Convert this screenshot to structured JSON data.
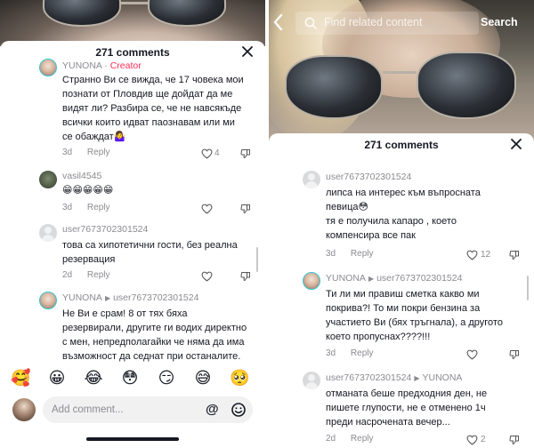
{
  "left": {
    "sheet_title": "271 comments",
    "comments": [
      {
        "user": "YUNONA",
        "badge": "Creator",
        "text": "Странно Ви се вижда, че 17 човека мои\nпознати от Пловдив ще дойдат да ме\nвидят ли? Разбира се, че не навсякъде\nвсички които идват паознавам или ми\nсе обаждат🤷‍♀️",
        "age": "3d",
        "reply": "Reply",
        "likes": "4"
      },
      {
        "user": "vasil4545",
        "text": "😁😁😁😁😁",
        "age": "3d",
        "reply": "Reply",
        "likes": ""
      },
      {
        "user": "user7673702301524",
        "text": "това са хипотетични гости, без реална\nрезервация",
        "age": "2d",
        "reply": "Reply",
        "likes": ""
      },
      {
        "user": "YUNONA",
        "reply_to": "user7673702301524",
        "text": "Не Ви е срам! 8 от тях бяха\nрезервирали, другите ги водих директно\nс мен, непредполагайки че няма да има\nвъзможност да седнат при останалите.",
        "age": "",
        "reply": "",
        "likes": ""
      }
    ],
    "emojis": [
      "🥰",
      "😀",
      "😂",
      "😳",
      "😏",
      "😅",
      "🥺"
    ],
    "comment_placeholder": "Add comment...",
    "at_symbol": "@"
  },
  "right": {
    "search_placeholder": "Find related content",
    "search_button": "Search",
    "sheet_title": "271 comments",
    "comments": [
      {
        "user": "user7673702301524",
        "text": "липса на интерес към въпросната\nпевица😳\nтя е получила капаро , което\nкомпенсира все пак",
        "age": "3d",
        "reply": "Reply",
        "likes": "12"
      },
      {
        "user": "YUNONA",
        "reply_to": "user7673702301524",
        "text": "Ти ли ми правиш сметка какво ми\nпокрива?! То ми покри бензина за\nучастието Ви (бях тръгнала), а другото\nкоето пропуснах????!!!",
        "age": "3d",
        "reply": "Reply",
        "likes": ""
      },
      {
        "user": "user7673702301524",
        "reply_to": "YUNONA",
        "text": "отманата беше предходния ден, не\nпишете глупости, не е отменено 1ч\nпреди насрочената вечер...",
        "age": "2d",
        "reply": "Reply",
        "likes": "2"
      }
    ]
  },
  "colors": {
    "text": "#161823",
    "muted": "#8a8b91",
    "creator": "#fe2c55",
    "ring": "#38c6d6",
    "input_bg": "#f1f1f2"
  }
}
